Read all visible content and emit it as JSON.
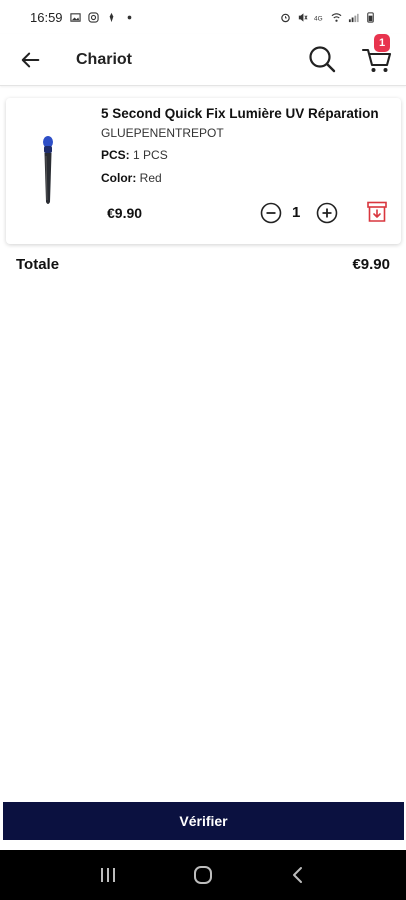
{
  "status_bar": {
    "time": "16:59",
    "left_icons": [
      "gallery-icon",
      "instagram-icon",
      "notification-icon",
      "dot-icon"
    ],
    "right_icons": [
      "alarm-icon",
      "mute-icon",
      "volte-icon",
      "wifi-icon",
      "signal-icon",
      "battery-icon"
    ]
  },
  "app_bar": {
    "title": "Chariot",
    "cart_count": "1"
  },
  "cart_item": {
    "title": "5 Second Quick Fix Lumière UV Réparation",
    "seller": "GLUEPENENTREPOT",
    "pcs_label": "PCS:",
    "pcs_value": "1 PCS",
    "color_label": "Color:",
    "color_value": "Red",
    "price": "€9.90",
    "quantity": "1"
  },
  "total": {
    "label": "Totale",
    "value": "€9.90"
  },
  "checkout": {
    "label": "Vérifier"
  },
  "colors": {
    "accent": "#0b1140",
    "badge": "#e8344e",
    "delete": "#d9363e"
  }
}
